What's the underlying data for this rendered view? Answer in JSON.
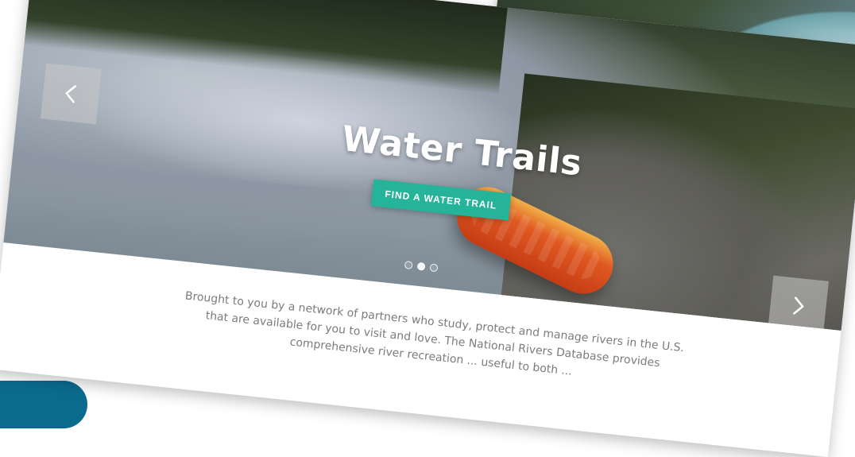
{
  "hero": {
    "title": "Water Trails",
    "cta_label": "FIND A WATER TRAIL",
    "carousel": {
      "dots_total": 3,
      "active_index": 1
    }
  },
  "main": {
    "body_text": "Brought to you by a network of partners who study, protect and manage rivers in the U.S. that are available for you to visit and love. The National Rivers Database provides comprehensive river recreation ... useful to both ..."
  },
  "icons": {
    "left_arrow": "chevron-left-icon",
    "right_arrow": "chevron-right-icon"
  },
  "edge": {
    "snippet_1": "a",
    "snippet_2": "ic",
    "snippet_3": "se"
  },
  "colors": {
    "accent": "#25b39a"
  }
}
